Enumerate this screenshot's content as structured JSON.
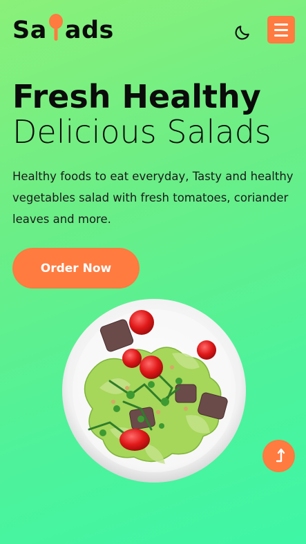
{
  "header": {
    "logo_prefix": "Sa",
    "logo_suffix": "ads",
    "moon_icon": "moon-icon",
    "menu_icon": "hamburger-icon"
  },
  "hero": {
    "title_line1": "Fresh Healthy",
    "title_line2": "Delicious Salads",
    "description": "Healthy foods to eat everyday, Tasty and healthy vegetables salad with fresh tomatoes, coriander leaves and more.",
    "cta_label": "Order Now"
  },
  "scroll_top": {
    "icon": "arrow-up-icon"
  },
  "colors": {
    "accent": "#ff7b40",
    "text": "#0b0b0b",
    "bg_start": "#8af07a",
    "bg_end": "#3ef6a6"
  }
}
